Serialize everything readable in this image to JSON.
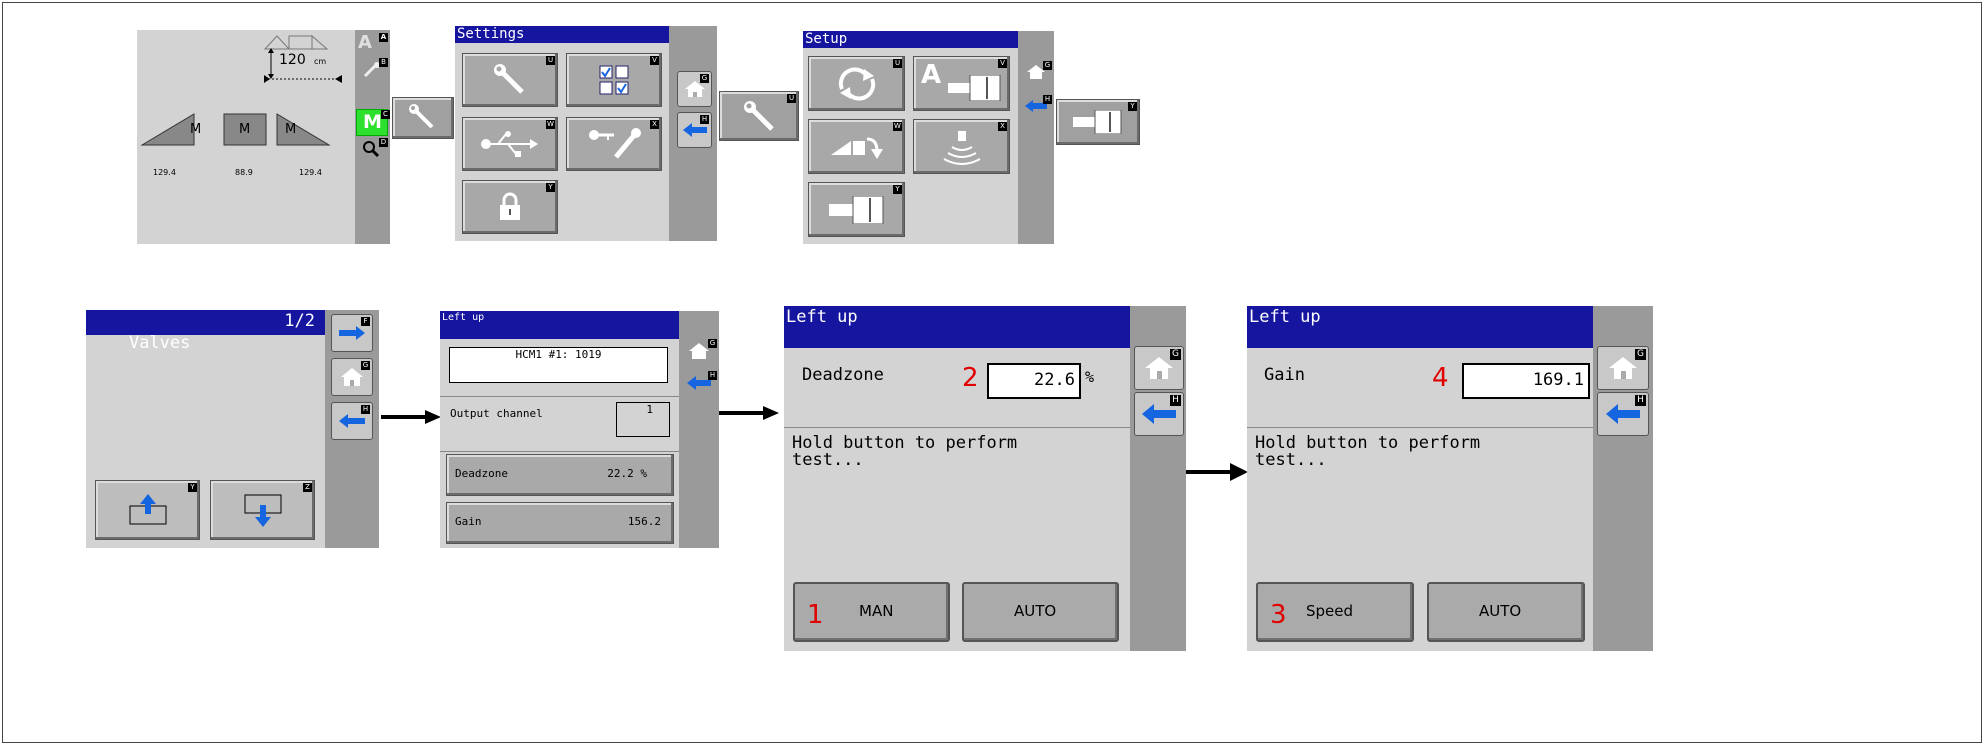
{
  "colors": {
    "title_bar": "#1515a0",
    "screen_bg": "#d3d3d3",
    "rail": "#9a9a9a",
    "accent_green": "#2de02d",
    "red_marker": "#e00000",
    "nav_blue": "#1565e0"
  },
  "home_screen": {
    "height_value": "120",
    "height_unit": "cm",
    "sections": [
      "M",
      "M",
      "M"
    ],
    "readings": [
      "129.4",
      "88.9",
      "129.4"
    ],
    "side_keys": [
      "A",
      "",
      "M",
      ""
    ],
    "key_letters": [
      "A",
      "B",
      "C",
      "D"
    ]
  },
  "settings": {
    "title": "Settings",
    "key_letters": [
      "U",
      "V",
      "W",
      "X",
      "Y"
    ],
    "nav_letters": [
      "G",
      "H"
    ]
  },
  "setup": {
    "title": "Setup",
    "key_letters": [
      "U",
      "V",
      "W",
      "X",
      "Y"
    ],
    "nav_letters": [
      "G",
      "H"
    ],
    "a_label": "A"
  },
  "standalone_keys": {
    "setup_key_letter": "U",
    "final_key_letter": "Y"
  },
  "valves": {
    "title": "Valves",
    "page": "1/2",
    "key_letters": [
      "Y",
      "Z"
    ],
    "nav_letters": [
      "F",
      "G",
      "H"
    ]
  },
  "left_up_list": {
    "title": "Left up",
    "module": "HCM1 #1: 1019",
    "output_label": "Output channel",
    "output_value": "1",
    "deadzone_label": "Deadzone",
    "deadzone_value": "22.2 %",
    "gain_label": "Gain",
    "gain_value": "156.2",
    "nav_letters": [
      "G",
      "H"
    ]
  },
  "deadzone_screen": {
    "title": "Left up",
    "label": "Deadzone",
    "marker": "2",
    "value": "22.6",
    "unit": "%",
    "message": "Hold button to perform\ntest...",
    "btn1_marker": "1",
    "btn1_label": "MAN",
    "btn2_label": "AUTO",
    "nav_letters": [
      "G",
      "H"
    ]
  },
  "gain_screen": {
    "title": "Left up",
    "label": "Gain",
    "marker": "4",
    "value": "169.1",
    "message": "Hold button to perform\ntest...",
    "btn1_marker": "3",
    "btn1_label": "Speed",
    "btn2_label": "AUTO",
    "nav_letters": [
      "G",
      "H"
    ]
  }
}
